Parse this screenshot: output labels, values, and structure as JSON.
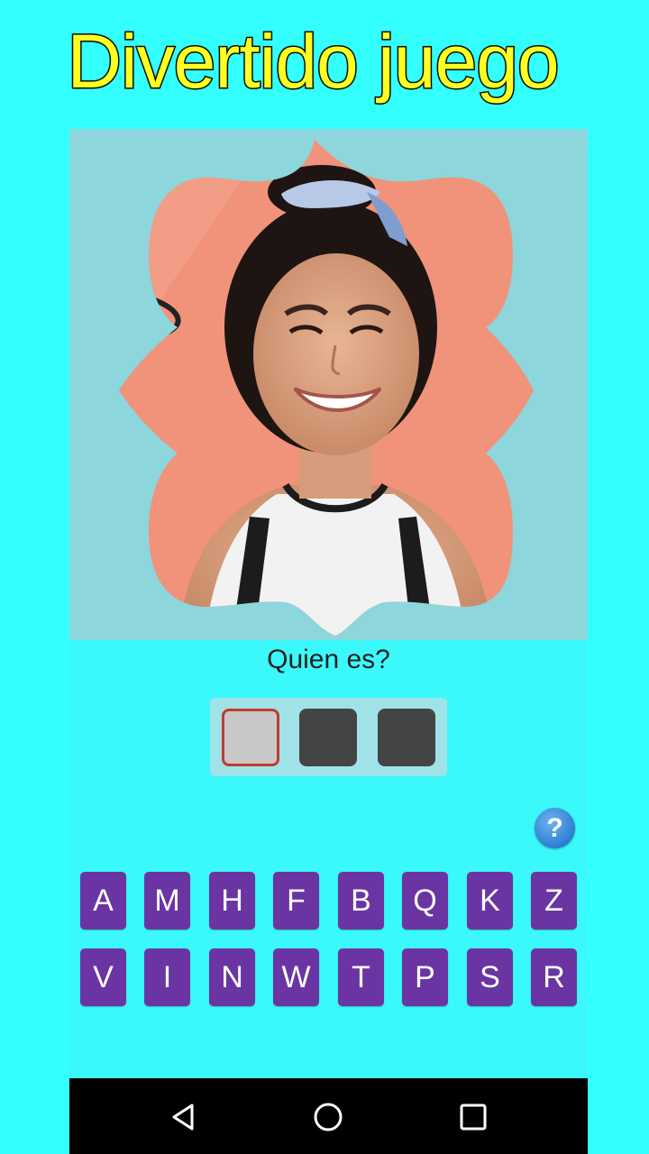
{
  "banner": {
    "title": "Divertido juego"
  },
  "colors": {
    "background": "#33ffff",
    "title_fill": "#ffff22",
    "key_fill": "#6a35a3",
    "slot_empty": "#444444",
    "slot_selected": "#c8c8c8",
    "slot_selected_border": "#c03b2f",
    "hint_button": "#2c7fd2"
  },
  "puzzle": {
    "image": "portrait-photo",
    "question": "Quien es?",
    "answer_slots": [
      "",
      "",
      ""
    ],
    "selected_slot": 1
  },
  "hint": {
    "icon": "question-mark-icon",
    "label": "?"
  },
  "keyboard": {
    "rows": [
      [
        "A",
        "M",
        "H",
        "F",
        "B",
        "Q",
        "K",
        "Z"
      ],
      [
        "V",
        "I",
        "N",
        "W",
        "T",
        "P",
        "S",
        "R"
      ]
    ]
  },
  "navbar": {
    "icons": [
      "back-icon",
      "home-icon",
      "recents-icon"
    ]
  }
}
